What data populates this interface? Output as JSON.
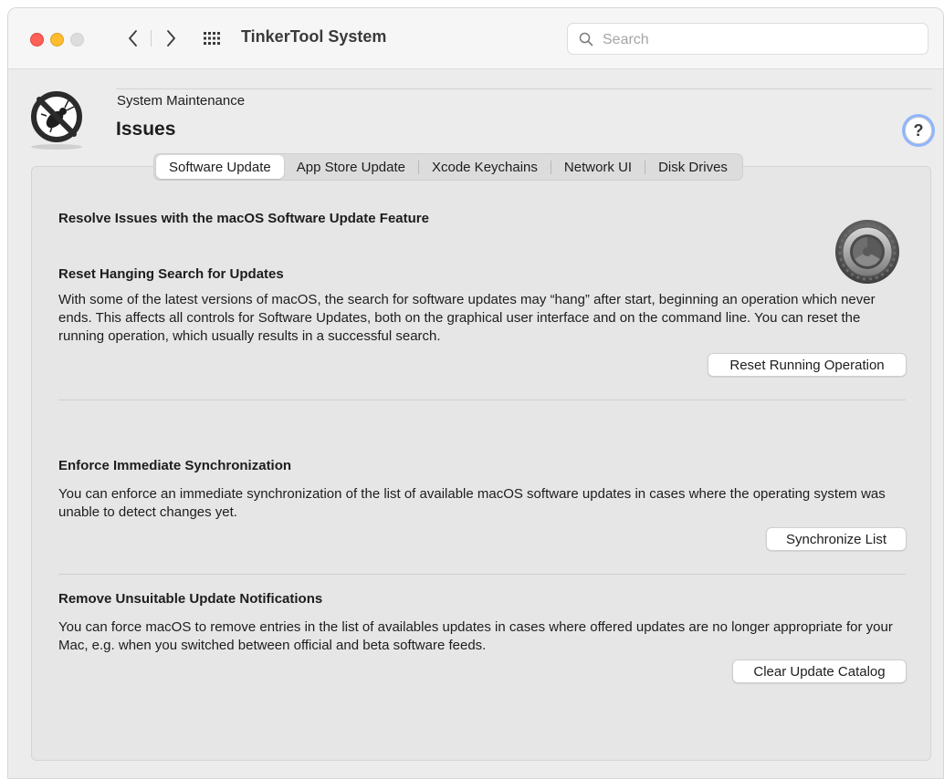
{
  "window": {
    "title": "TinkerTool System",
    "search_placeholder": "Search",
    "search_value": ""
  },
  "header": {
    "section": "System Maintenance",
    "title": "Issues",
    "help_label": "?"
  },
  "tabs": [
    {
      "label": "Software Update",
      "active": true
    },
    {
      "label": "App Store Update",
      "active": false
    },
    {
      "label": "Xcode Keychains",
      "active": false
    },
    {
      "label": "Network UI",
      "active": false
    },
    {
      "label": "Disk Drives",
      "active": false
    }
  ],
  "content": {
    "main_heading": "Resolve Issues with the macOS Software Update Feature",
    "sections": [
      {
        "heading": "Reset Hanging Search for Updates",
        "text": "With some of the latest versions of macOS, the search for software updates may “hang” after start, beginning an operation which never ends. This affects all controls for Software Updates, both on the graphical user interface and on the command line. You can reset the running operation, which usually results in a successful search.",
        "button": "Reset Running Operation"
      },
      {
        "heading": "Enforce Immediate Synchronization",
        "text": "You can enforce an immediate synchronization of the list of available macOS software updates in cases where the operating system was unable to detect changes yet.",
        "button": "Synchronize List"
      },
      {
        "heading": "Remove Unsuitable Update Notifications",
        "text": "You can force macOS to remove entries in the list of availables updates in cases where offered updates are no longer appropriate for your Mac, e.g. when you switched between official and beta software feeds.",
        "button": "Clear Update Catalog"
      }
    ]
  },
  "colors": {
    "close": "#fe5f57",
    "minimize": "#febc2e",
    "zoom_disabled": "#dddddd",
    "focus_ring": "#8fb5ff"
  },
  "icons": {
    "app": "no-bug-icon",
    "back": "chevron-left-icon",
    "forward": "chevron-right-icon",
    "grid": "grid-icon",
    "search": "search-icon",
    "help": "help-icon",
    "software_update": "gear-icon"
  }
}
